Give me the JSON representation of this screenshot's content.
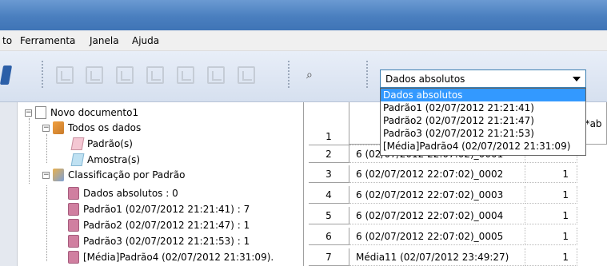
{
  "menu": {
    "items": [
      "to",
      "Ferramenta",
      "Janela",
      "Ajuda"
    ]
  },
  "toolbar": {
    "combo_value": "Dados absolutos",
    "options": [
      "Dados absolutos",
      "Padrão1 (02/07/2012 21:21:41)",
      "Padrão2 (02/07/2012 21:21:47)",
      "Padrão3 (02/07/2012 21:21:53)",
      "[Média]Padrão4 (02/07/2012 21:31:09)"
    ]
  },
  "tree": {
    "root": "Novo documento1",
    "all_data": "Todos os dados",
    "standards": "Padrão(s)",
    "samples": "Amostra(s)",
    "classification": "Classificação por Padrão",
    "class_items": [
      "Dados absolutos : 0",
      "Padrão1 (02/07/2012 21:21:41) : 7",
      "Padrão2 (02/07/2012 21:21:47) : 1",
      "Padrão3 (02/07/2012 21:21:53) : 1",
      "[Média]Padrão4 (02/07/2012 21:31:09)."
    ]
  },
  "grid": {
    "header_partial": "E*ab",
    "rows": [
      {
        "num": "1",
        "name": "",
        "val": ""
      },
      {
        "num": "2",
        "name": "6 (02/07/2012 22:07:02)_0001",
        "val": ""
      },
      {
        "num": "3",
        "name": "6 (02/07/2012 22:07:02)_0002",
        "val": "1"
      },
      {
        "num": "4",
        "name": "6 (02/07/2012 22:07:02)_0003",
        "val": "1"
      },
      {
        "num": "5",
        "name": "6 (02/07/2012 22:07:02)_0004",
        "val": "1"
      },
      {
        "num": "6",
        "name": "6 (02/07/2012 22:07:02)_0005",
        "val": "1"
      },
      {
        "num": "7",
        "name": "Média11 (02/07/2012 23:49:27)",
        "val": "1"
      }
    ]
  }
}
